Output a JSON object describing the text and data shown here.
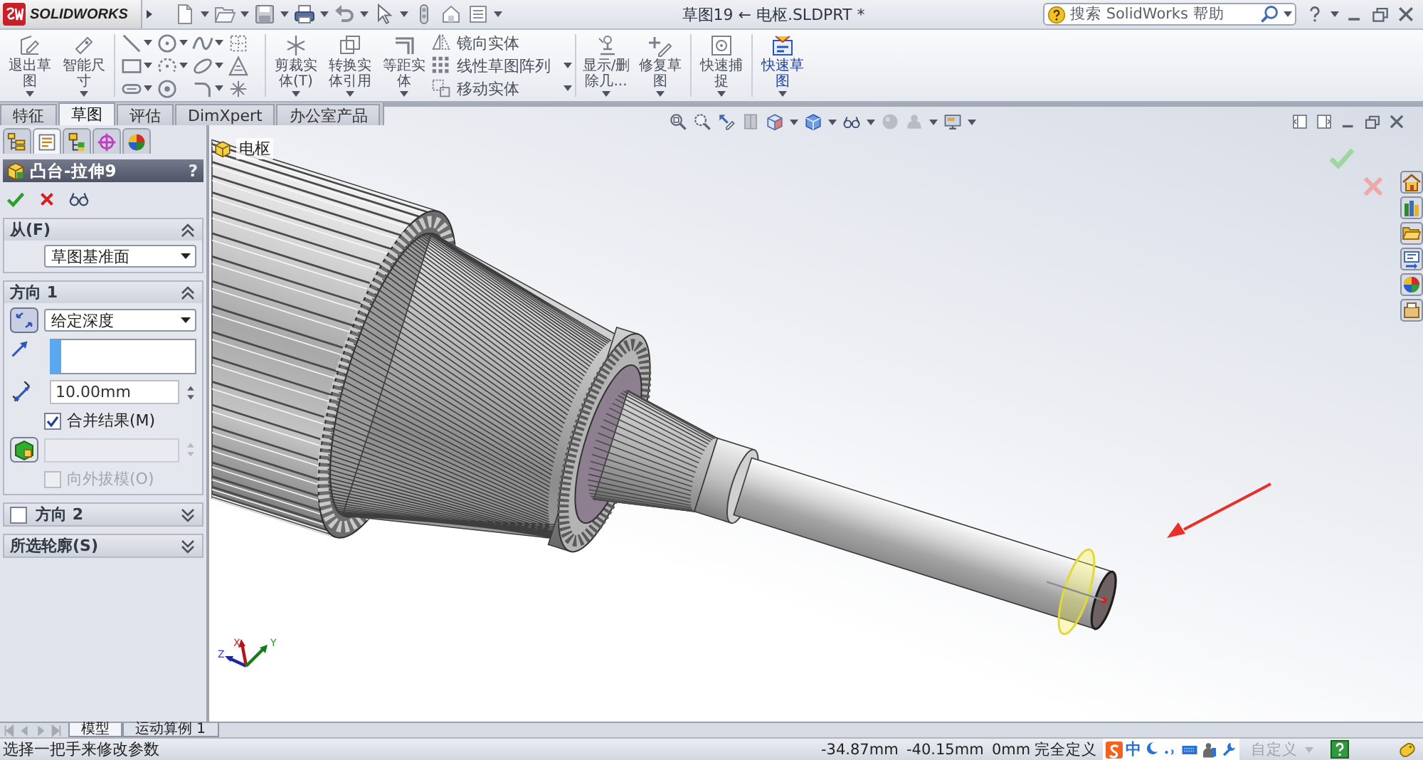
{
  "title_bar": {
    "app_name": "SOLIDWORKS",
    "document_title": "草图19 ← 电枢.SLDPRT *",
    "search": {
      "placeholder": "搜索 SolidWorks 帮助"
    }
  },
  "command_manager": {
    "sketch_buttons": [
      {
        "label": "退出草图"
      },
      {
        "label": "智能尺寸"
      }
    ],
    "edit_buttons": [
      {
        "label": "剪裁实体(T)"
      },
      {
        "label": "转换实体引用"
      },
      {
        "label": "等距实体"
      }
    ],
    "small_tools": [
      {
        "label": "镜向实体"
      },
      {
        "label": "线性草图阵列"
      },
      {
        "label": "移动实体"
      }
    ],
    "display_buttons": [
      {
        "label": "显示/删除几...",
        "on": false
      },
      {
        "label": "修复草图",
        "on": false
      },
      {
        "label": "快速捕捉",
        "on": false
      },
      {
        "label": "快速草图",
        "on": true
      }
    ],
    "tabs": [
      {
        "label": "特征",
        "selected": false
      },
      {
        "label": "草图",
        "selected": true
      },
      {
        "label": "评估",
        "selected": false
      },
      {
        "label": "DimXpert",
        "selected": false
      },
      {
        "label": "办公室产品",
        "selected": false
      }
    ]
  },
  "property_manager": {
    "panel_tabs": [
      {
        "selected": false
      },
      {
        "selected": true
      },
      {
        "selected": false
      },
      {
        "selected": false
      },
      {
        "selected": false
      }
    ],
    "title": "凸台-拉伸9",
    "help": "?",
    "from_section": {
      "title": "从(F)",
      "expanded": true,
      "start_condition": "草图基准面"
    },
    "direction1_section": {
      "title": "方向 1",
      "expanded": true,
      "end_condition": "给定深度",
      "depth": "10.00mm",
      "merge_result": {
        "label": "合并结果(M)",
        "checked": true
      },
      "draft_outward": {
        "label": "向外拔模(O)",
        "checked": false,
        "disabled": true
      }
    },
    "direction2_section": {
      "title": "方向 2",
      "expanded": false,
      "checked": false
    },
    "contours_section": {
      "title": "所选轮廓(S)",
      "expanded": false
    }
  },
  "viewport": {
    "breadcrumb": "电枢",
    "triad": {
      "x": "X",
      "y": "Y",
      "z": "Z"
    }
  },
  "bottom_tabs": [
    {
      "label": "模型",
      "selected": true
    },
    {
      "label": "运动算例 1",
      "selected": false
    }
  ],
  "status_bar": {
    "message": "选择一把手来修改参数",
    "x_coordinate": "-34.87mm",
    "y_coordinate": "-40.15mm",
    "z_coordinate": "0mm",
    "sketch_state": "完全定义",
    "input_mode": "中",
    "unit_system": "自定义"
  }
}
